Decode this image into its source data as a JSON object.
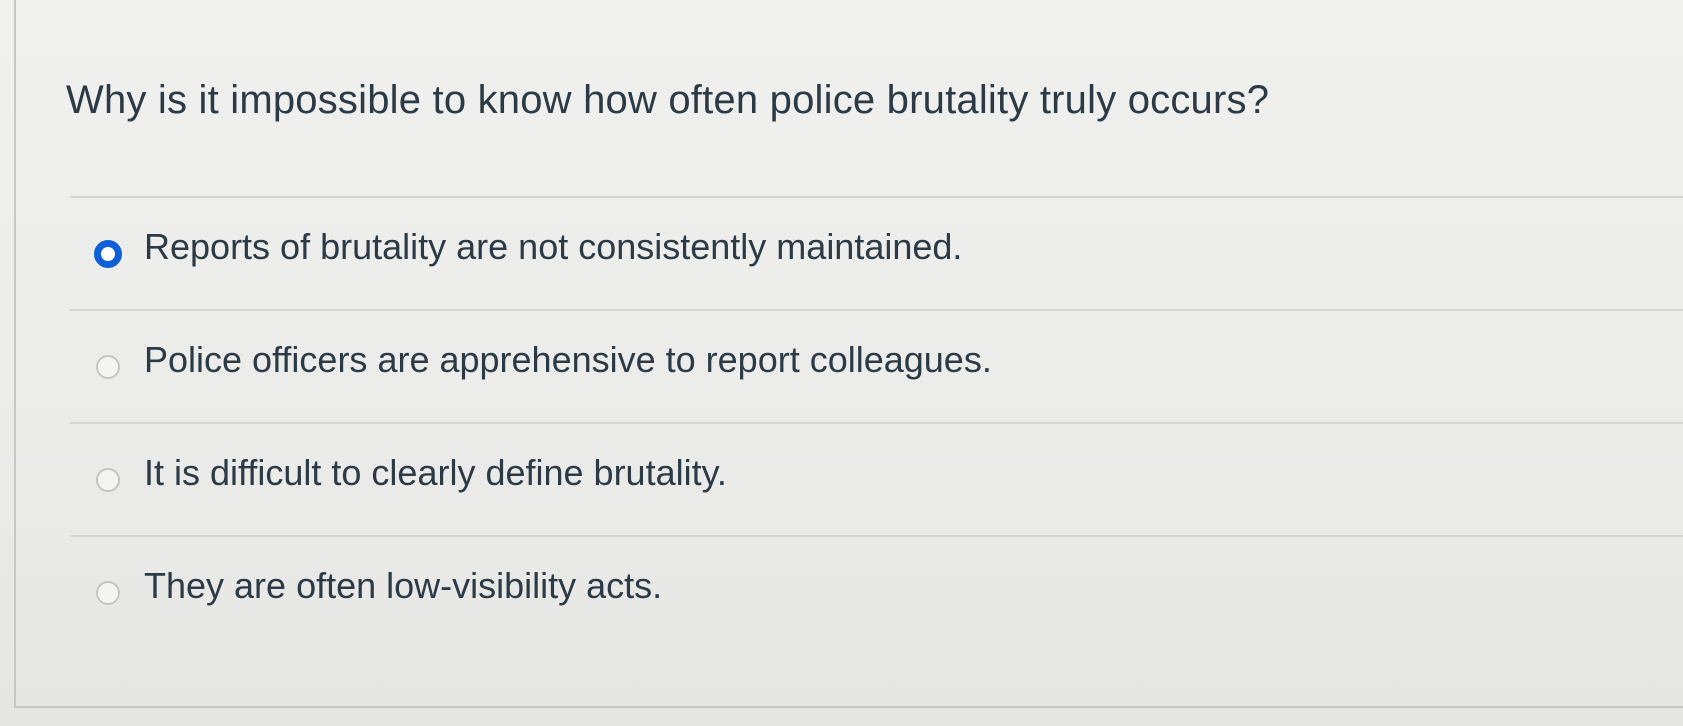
{
  "question": {
    "text": "Why is it impossible to know how often police brutality truly occurs?"
  },
  "answers": [
    {
      "label": "Reports of brutality are not consistently maintained.",
      "selected": true
    },
    {
      "label": "Police officers are apprehensive to report colleagues.",
      "selected": false
    },
    {
      "label": "It is difficult to clearly define brutality.",
      "selected": false
    },
    {
      "label": "They are often low-visibility acts.",
      "selected": false
    }
  ],
  "colors": {
    "selected_radio": "#0f5fd6",
    "text": "#2b3a44",
    "divider": "#d4d4d2"
  }
}
